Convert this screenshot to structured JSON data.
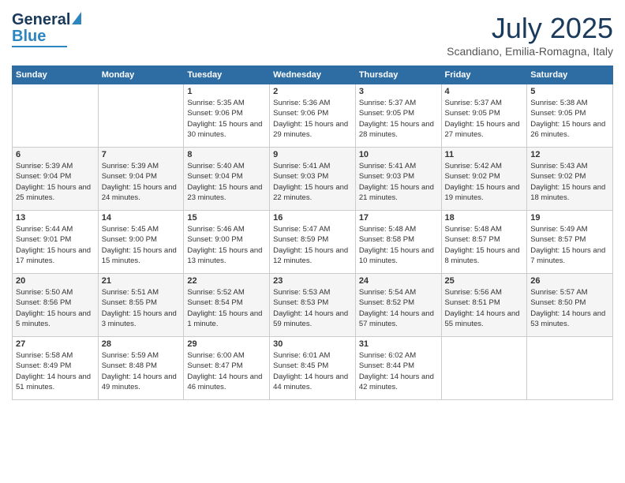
{
  "header": {
    "logo_line1": "General",
    "logo_line2": "Blue",
    "month_title": "July 2025",
    "location": "Scandiano, Emilia-Romagna, Italy"
  },
  "weekdays": [
    "Sunday",
    "Monday",
    "Tuesday",
    "Wednesday",
    "Thursday",
    "Friday",
    "Saturday"
  ],
  "weeks": [
    [
      {
        "day": "",
        "info": ""
      },
      {
        "day": "",
        "info": ""
      },
      {
        "day": "1",
        "info": "Sunrise: 5:35 AM\nSunset: 9:06 PM\nDaylight: 15 hours and 30 minutes."
      },
      {
        "day": "2",
        "info": "Sunrise: 5:36 AM\nSunset: 9:06 PM\nDaylight: 15 hours and 29 minutes."
      },
      {
        "day": "3",
        "info": "Sunrise: 5:37 AM\nSunset: 9:05 PM\nDaylight: 15 hours and 28 minutes."
      },
      {
        "day": "4",
        "info": "Sunrise: 5:37 AM\nSunset: 9:05 PM\nDaylight: 15 hours and 27 minutes."
      },
      {
        "day": "5",
        "info": "Sunrise: 5:38 AM\nSunset: 9:05 PM\nDaylight: 15 hours and 26 minutes."
      }
    ],
    [
      {
        "day": "6",
        "info": "Sunrise: 5:39 AM\nSunset: 9:04 PM\nDaylight: 15 hours and 25 minutes."
      },
      {
        "day": "7",
        "info": "Sunrise: 5:39 AM\nSunset: 9:04 PM\nDaylight: 15 hours and 24 minutes."
      },
      {
        "day": "8",
        "info": "Sunrise: 5:40 AM\nSunset: 9:04 PM\nDaylight: 15 hours and 23 minutes."
      },
      {
        "day": "9",
        "info": "Sunrise: 5:41 AM\nSunset: 9:03 PM\nDaylight: 15 hours and 22 minutes."
      },
      {
        "day": "10",
        "info": "Sunrise: 5:41 AM\nSunset: 9:03 PM\nDaylight: 15 hours and 21 minutes."
      },
      {
        "day": "11",
        "info": "Sunrise: 5:42 AM\nSunset: 9:02 PM\nDaylight: 15 hours and 19 minutes."
      },
      {
        "day": "12",
        "info": "Sunrise: 5:43 AM\nSunset: 9:02 PM\nDaylight: 15 hours and 18 minutes."
      }
    ],
    [
      {
        "day": "13",
        "info": "Sunrise: 5:44 AM\nSunset: 9:01 PM\nDaylight: 15 hours and 17 minutes."
      },
      {
        "day": "14",
        "info": "Sunrise: 5:45 AM\nSunset: 9:00 PM\nDaylight: 15 hours and 15 minutes."
      },
      {
        "day": "15",
        "info": "Sunrise: 5:46 AM\nSunset: 9:00 PM\nDaylight: 15 hours and 13 minutes."
      },
      {
        "day": "16",
        "info": "Sunrise: 5:47 AM\nSunset: 8:59 PM\nDaylight: 15 hours and 12 minutes."
      },
      {
        "day": "17",
        "info": "Sunrise: 5:48 AM\nSunset: 8:58 PM\nDaylight: 15 hours and 10 minutes."
      },
      {
        "day": "18",
        "info": "Sunrise: 5:48 AM\nSunset: 8:57 PM\nDaylight: 15 hours and 8 minutes."
      },
      {
        "day": "19",
        "info": "Sunrise: 5:49 AM\nSunset: 8:57 PM\nDaylight: 15 hours and 7 minutes."
      }
    ],
    [
      {
        "day": "20",
        "info": "Sunrise: 5:50 AM\nSunset: 8:56 PM\nDaylight: 15 hours and 5 minutes."
      },
      {
        "day": "21",
        "info": "Sunrise: 5:51 AM\nSunset: 8:55 PM\nDaylight: 15 hours and 3 minutes."
      },
      {
        "day": "22",
        "info": "Sunrise: 5:52 AM\nSunset: 8:54 PM\nDaylight: 15 hours and 1 minute."
      },
      {
        "day": "23",
        "info": "Sunrise: 5:53 AM\nSunset: 8:53 PM\nDaylight: 14 hours and 59 minutes."
      },
      {
        "day": "24",
        "info": "Sunrise: 5:54 AM\nSunset: 8:52 PM\nDaylight: 14 hours and 57 minutes."
      },
      {
        "day": "25",
        "info": "Sunrise: 5:56 AM\nSunset: 8:51 PM\nDaylight: 14 hours and 55 minutes."
      },
      {
        "day": "26",
        "info": "Sunrise: 5:57 AM\nSunset: 8:50 PM\nDaylight: 14 hours and 53 minutes."
      }
    ],
    [
      {
        "day": "27",
        "info": "Sunrise: 5:58 AM\nSunset: 8:49 PM\nDaylight: 14 hours and 51 minutes."
      },
      {
        "day": "28",
        "info": "Sunrise: 5:59 AM\nSunset: 8:48 PM\nDaylight: 14 hours and 49 minutes."
      },
      {
        "day": "29",
        "info": "Sunrise: 6:00 AM\nSunset: 8:47 PM\nDaylight: 14 hours and 46 minutes."
      },
      {
        "day": "30",
        "info": "Sunrise: 6:01 AM\nSunset: 8:45 PM\nDaylight: 14 hours and 44 minutes."
      },
      {
        "day": "31",
        "info": "Sunrise: 6:02 AM\nSunset: 8:44 PM\nDaylight: 14 hours and 42 minutes."
      },
      {
        "day": "",
        "info": ""
      },
      {
        "day": "",
        "info": ""
      }
    ]
  ]
}
